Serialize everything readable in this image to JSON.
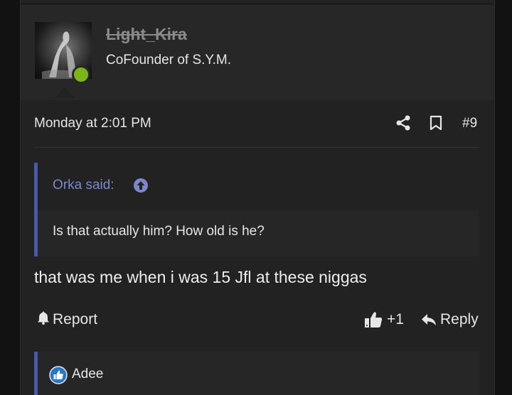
{
  "user": {
    "name": "Light_Kira",
    "title": "CoFounder of S.Y.M.",
    "status_color": "#7cb518"
  },
  "post": {
    "date": "Monday at 2:01 PM",
    "number": "#9",
    "message": "that was me when i was 15 Jfl at these niggas"
  },
  "quote": {
    "author": "Orka said:",
    "text": "Is that actually him? How old is he?"
  },
  "actions": {
    "report_label": "Report",
    "like_count": "+1",
    "reply_label": "Reply"
  },
  "likes": {
    "names": "Adee"
  },
  "icons": {
    "share": "share-icon",
    "bookmark": "bookmark-icon",
    "quote_up": "arrow-up-circle-icon",
    "report": "bell-icon",
    "like": "thumbs-up-icon",
    "reply": "reply-icon",
    "likes_badge": "like-badge-icon"
  },
  "colors": {
    "quote_accent": "#4a5aa8",
    "quote_author": "#7b88c8",
    "likes_badge": "#2577c9"
  }
}
